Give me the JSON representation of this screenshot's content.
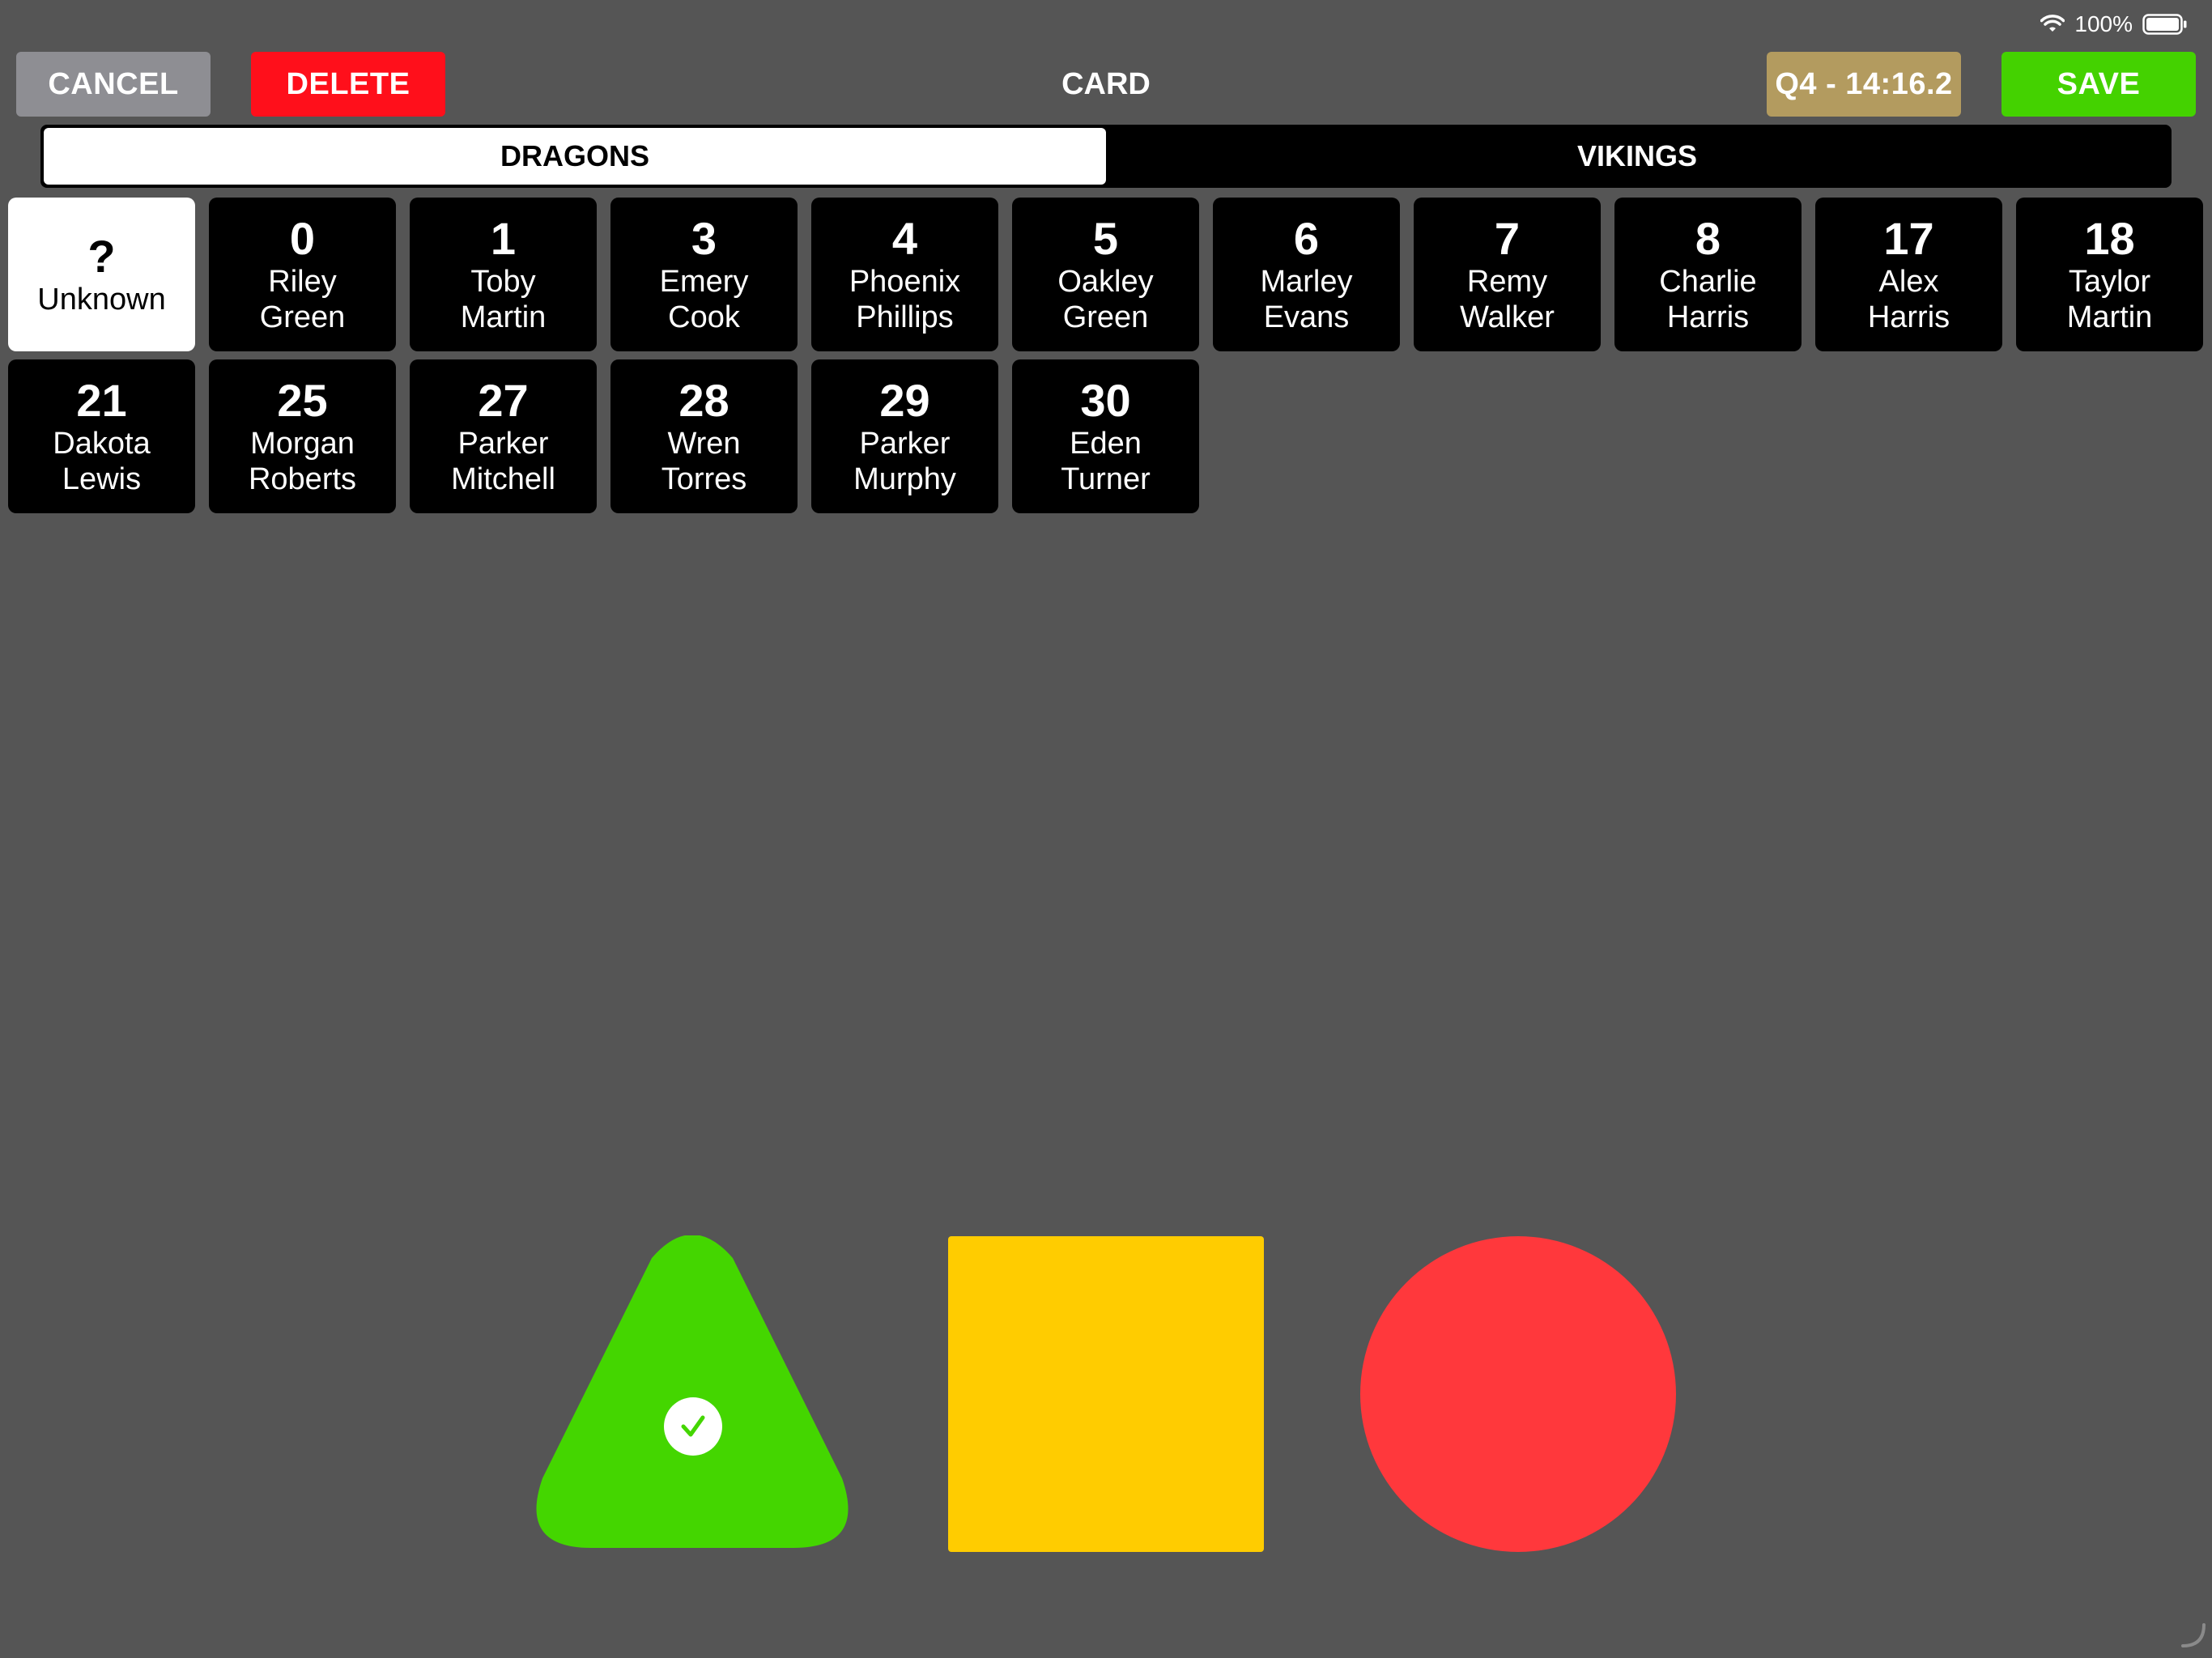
{
  "status_bar": {
    "battery_text": "100%",
    "icons": [
      "wifi-icon",
      "battery-icon"
    ]
  },
  "toolbar": {
    "cancel_label": "CANCEL",
    "delete_label": "DELETE",
    "title": "CARD",
    "clock_label": "Q4 - 14:16.2",
    "save_label": "SAVE"
  },
  "teams": {
    "selected": "DRAGONS",
    "tabs": [
      {
        "label": "DRAGONS"
      },
      {
        "label": "VIKINGS"
      }
    ]
  },
  "players": [
    {
      "number": "?",
      "first": "Unknown",
      "last": "",
      "selected": true
    },
    {
      "number": "0",
      "first": "Riley",
      "last": "Green"
    },
    {
      "number": "1",
      "first": "Toby",
      "last": "Martin"
    },
    {
      "number": "3",
      "first": "Emery",
      "last": "Cook"
    },
    {
      "number": "4",
      "first": "Phoenix",
      "last": "Phillips"
    },
    {
      "number": "5",
      "first": "Oakley",
      "last": "Green"
    },
    {
      "number": "6",
      "first": "Marley",
      "last": "Evans"
    },
    {
      "number": "7",
      "first": "Remy",
      "last": "Walker"
    },
    {
      "number": "8",
      "first": "Charlie",
      "last": "Harris"
    },
    {
      "number": "17",
      "first": "Alex",
      "last": "Harris"
    },
    {
      "number": "18",
      "first": "Taylor",
      "last": "Martin"
    },
    {
      "number": "21",
      "first": "Dakota",
      "last": "Lewis"
    },
    {
      "number": "25",
      "first": "Morgan",
      "last": "Roberts"
    },
    {
      "number": "27",
      "first": "Parker",
      "last": "Mitchell"
    },
    {
      "number": "28",
      "first": "Wren",
      "last": "Torres"
    },
    {
      "number": "29",
      "first": "Parker",
      "last": "Murphy"
    },
    {
      "number": "30",
      "first": "Eden",
      "last": "Turner"
    }
  ],
  "cards": [
    {
      "shape": "triangle",
      "color": "#44d600",
      "selected": true,
      "icon": "checkmark-icon"
    },
    {
      "shape": "square",
      "color": "#ffcc00",
      "selected": false
    },
    {
      "shape": "circle",
      "color": "#ff383c",
      "selected": false
    }
  ],
  "colors": {
    "background": "#555555",
    "cancel": "#8e8e93",
    "delete": "#ff0f1b",
    "clock": "#b39b5f",
    "save": "#44d200"
  }
}
